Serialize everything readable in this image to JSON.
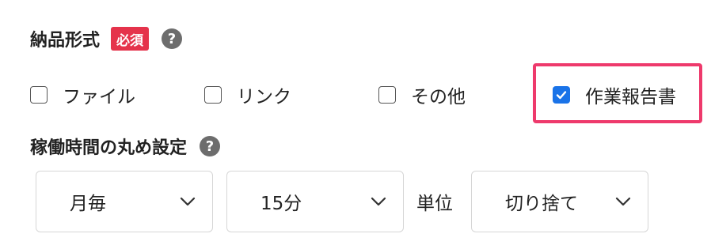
{
  "delivery_format": {
    "title": "納品形式",
    "required_badge": "必須",
    "help_icon": "?",
    "options": [
      {
        "label": "ファイル",
        "checked": false
      },
      {
        "label": "リンク",
        "checked": false
      },
      {
        "label": "その他",
        "checked": false
      },
      {
        "label": "作業報告書",
        "checked": true
      }
    ]
  },
  "rounding": {
    "title": "稼働時間の丸め設定",
    "help_icon": "?",
    "period_value": "月毎",
    "increment_value": "15分",
    "unit_label": "単位",
    "method_value": "切り捨て"
  },
  "icons": {
    "help": "question-circle-icon",
    "chevron": "chevron-down-icon",
    "check": "checkmark-icon"
  },
  "colors": {
    "required_badge": "#e5334b",
    "help_icon": "#6d6d6d",
    "checkbox_checked": "#1a73e8",
    "highlight": "#ee3a6c"
  }
}
